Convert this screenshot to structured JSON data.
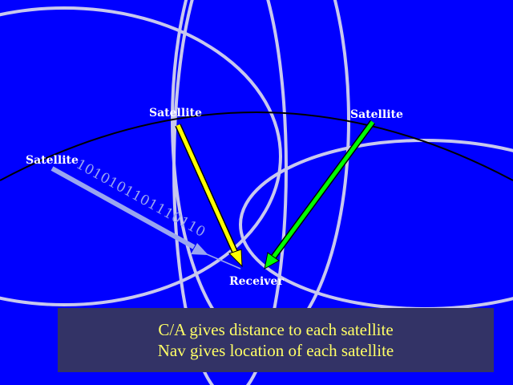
{
  "satellites": {
    "left_label": "Satellite",
    "center_label": "Satellite",
    "right_label": "Satellite"
  },
  "receiver_label": "Receiver",
  "bitstream": "1010101101110110",
  "caption": {
    "line1": "C/A gives distance to each satellite",
    "line2": "Nav gives location of each satellite"
  },
  "colors": {
    "background": "#0000ff",
    "ellipse_outline": "#c8c8ee",
    "earth_curve": "#000000",
    "left_signal": "#9aa6f0",
    "center_signal": "#ffff00",
    "right_signal": "#00ff00",
    "caption_text": "#ffff66",
    "caption_bg": "#333366"
  }
}
